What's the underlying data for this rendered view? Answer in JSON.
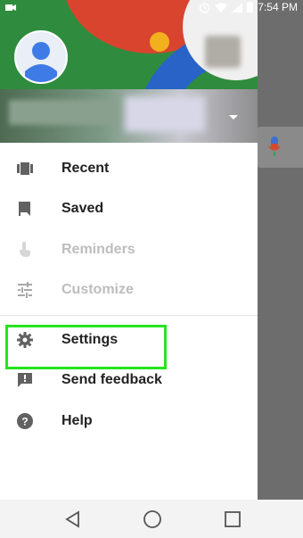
{
  "status_bar": {
    "time": "7:54 PM",
    "icons": [
      "video-icon",
      "alarm-icon",
      "wifi-icon",
      "signal-icon",
      "battery-icon"
    ]
  },
  "drawer": {
    "menu": [
      {
        "label": "Recent",
        "icon": "recent-icon",
        "enabled": true
      },
      {
        "label": "Saved",
        "icon": "bookmark-icon",
        "enabled": true
      },
      {
        "label": "Reminders",
        "icon": "reminder-icon",
        "enabled": false
      },
      {
        "label": "Customize",
        "icon": "tune-icon",
        "enabled": false
      },
      {
        "label": "Settings",
        "icon": "gear-icon",
        "enabled": true,
        "highlighted": true
      },
      {
        "label": "Send feedback",
        "icon": "feedback-icon",
        "enabled": true
      },
      {
        "label": "Help",
        "icon": "help-icon",
        "enabled": true
      }
    ]
  },
  "nav_bar": {
    "buttons": [
      "back-icon",
      "home-icon",
      "recents-icon"
    ]
  },
  "colors": {
    "highlight": "#27e41f",
    "text_primary": "#222222",
    "text_disabled": "#bdbdbd"
  }
}
